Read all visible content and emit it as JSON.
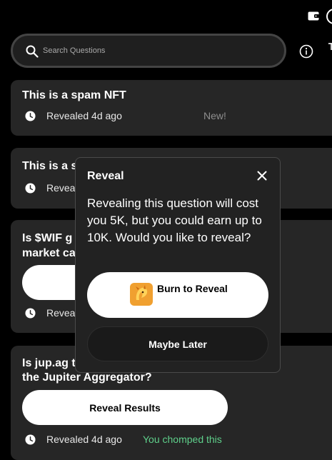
{
  "search": {
    "placeholder": "Search Questions"
  },
  "cards": [
    {
      "title": "This is a spam NFT",
      "revealed": "Revealed 4d ago",
      "tag": "New!"
    },
    {
      "title": "This is a s",
      "revealed": "Reveale"
    },
    {
      "title_line1": "Is $WIF g",
      "title_line2": "market ca",
      "revealed": "Reveale"
    },
    {
      "title_line1": "Is jup.ag t",
      "title_line2": "the Jupiter Aggregator?",
      "button": "Reveal Results",
      "revealed": "Revealed 4d ago",
      "tag": "You chomped this"
    }
  ],
  "modal": {
    "title": "Reveal",
    "body": "Revealing this question will cost you 5K, but you could earn up to 10K. Would you like to reveal?",
    "burn_label": "Burn to Reveal",
    "later_label": "Maybe Later"
  },
  "colors": {
    "tag_new": "#8e8e8e",
    "tag_chomped": "#5fd08b",
    "accent_orange": "#f0a030"
  },
  "icons": [
    "wallet-icon",
    "profile-icon",
    "search-icon",
    "info-icon",
    "clock-icon",
    "close-icon",
    "bonk-token-icon"
  ]
}
